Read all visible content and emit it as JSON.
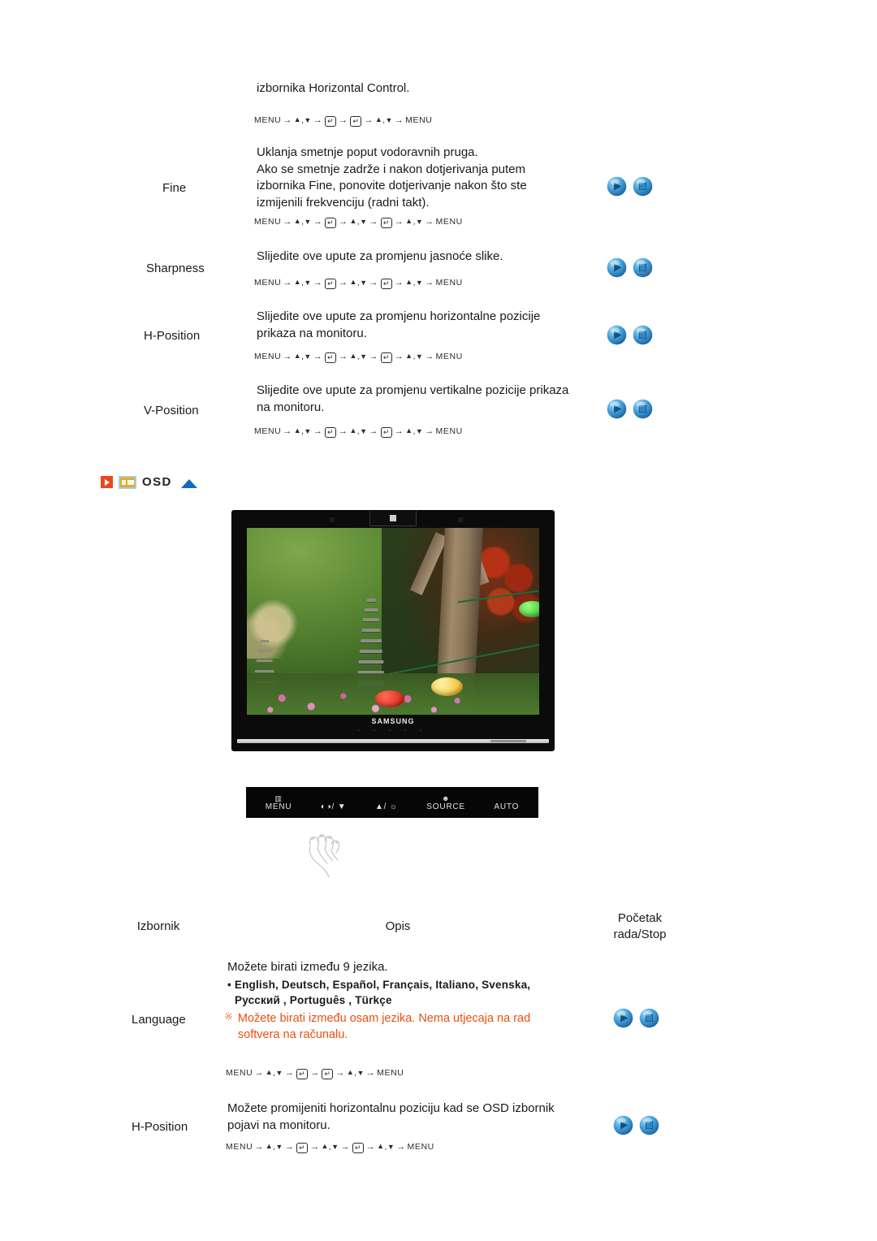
{
  "document": {
    "language": "hr",
    "type": "monitor-user-manual-page"
  },
  "top_section": {
    "intro_line": "izbornika Horizontal Control.",
    "intro_menu_path": "MENU → ▲ , ▼ → ↵ → ↵ → ▲ , ▼ → MENU",
    "rows": [
      {
        "label": "Fine",
        "description": "Uklanja smetnje poput vodoravnih pruga.\nAko se smetnje zadrže i nakon dotjerivanja putem\nizbornika Fine, ponovite dotjerivanje nakon što ste\nizmijenili frekvenciju (radni takt).",
        "desc_lines": [
          "Uklanja smetnje poput vodoravnih pruga.",
          "Ako se smetnje zadrže i nakon dotjerivanja putem",
          "izbornika Fine, ponovite dotjerivanje nakon što ste",
          "izmijenili frekvenciju (radni takt)."
        ],
        "menu_path_type": "long",
        "buttons": [
          "play-button",
          "stop-button"
        ]
      },
      {
        "label": "Sharpness",
        "desc_lines": [
          "Slijedite ove upute za promjenu jasnoće slike."
        ],
        "menu_path_type": "long",
        "buttons": [
          "play-button",
          "stop-button"
        ]
      },
      {
        "label": "H-Position",
        "desc_lines": [
          "Slijedite ove upute za promjenu horizontalne pozicije",
          "prikaza na monitoru."
        ],
        "menu_path_type": "long",
        "buttons": [
          "play-button",
          "stop-button"
        ]
      },
      {
        "label": "V-Position",
        "desc_lines": [
          "Slijedite ove upute za promjenu vertikalne pozicije prikaza",
          "na monitoru."
        ],
        "menu_path_type": "long",
        "buttons": [
          "play-button",
          "stop-button"
        ]
      }
    ]
  },
  "osd_section": {
    "title": "OSD",
    "icons": [
      "red-play-icon",
      "osd-box-icon",
      "blue-triangle-up-icon"
    ]
  },
  "monitor_figure": {
    "brand_logo": "SAMSUNG",
    "screen_content": "garden-photo-with-pagoda-and-lanterns",
    "control_panel": [
      {
        "glyph": "▥",
        "label": "MENU"
      },
      {
        "glyph": "◑",
        "label": "/ ▼"
      },
      {
        "glyph": "▲",
        "label": "/ ☼"
      },
      {
        "glyph": "☺",
        "label": "SOURCE"
      },
      {
        "glyph": "",
        "label": "AUTO"
      }
    ],
    "pointer": "hand-cursor"
  },
  "bottom_table": {
    "headers": {
      "menu": "Izbornik",
      "description": "Opis",
      "playstop": "Početak\nrada/Stop",
      "playstop_line1": "Početak",
      "playstop_line2": "rada/Stop"
    },
    "rows": [
      {
        "label": "Language",
        "desc_lines": [
          "Možete birati između 9 jezika."
        ],
        "language_list_line1": "• English, Deutsch, Español, Français,  Italiano, Svenska,",
        "language_list_line2": "Русский , Português , Türkçe",
        "warning_mark": "※",
        "warning_lines": [
          "Možete birati između osam jezika. Nema utjecaja na rad",
          "softvera na računalu."
        ],
        "menu_path_type": "short",
        "buttons": [
          "play-button",
          "stop-button"
        ]
      },
      {
        "label": "H-Position",
        "desc_lines": [
          "Možete promijeniti horizontalnu poziciju kad se OSD izbornik",
          "pojavi na monitoru."
        ],
        "menu_path_type": "long",
        "buttons": [
          "play-button",
          "stop-button"
        ]
      }
    ]
  },
  "menu_paths": {
    "word_menu": "MENU",
    "tri_up": "▲",
    "tri_down": "▼",
    "arrow": "→",
    "comma": ",",
    "enter_key": "↵"
  },
  "colors": {
    "warning_orange": "#e8500f",
    "warning_mark": "#ef8a3c",
    "accent_red": "#e8491d",
    "accent_amber": "#f0a81e",
    "accent_blue": "#1569c0",
    "orb_blue": "#2b8fd6"
  }
}
